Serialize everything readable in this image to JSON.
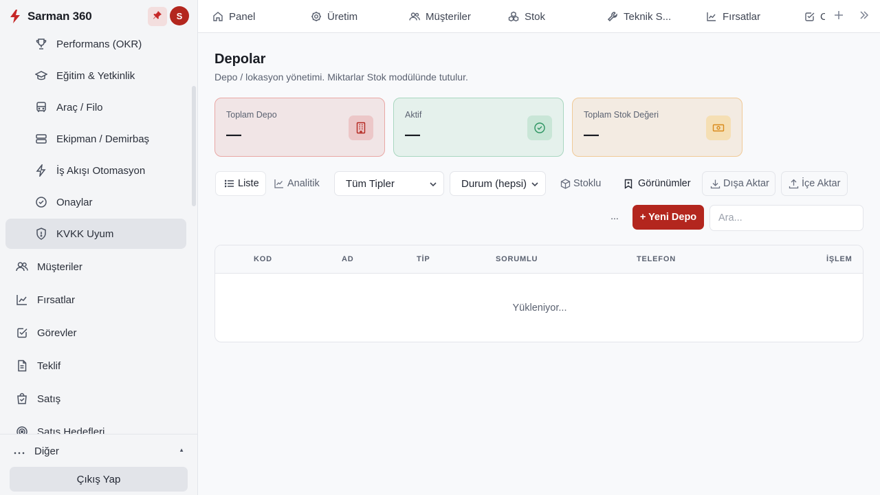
{
  "app": {
    "title": "Sarman 360",
    "avatar_initial": "S",
    "accent": "#b3261e"
  },
  "sidebar": {
    "sub_items": [
      {
        "label": "Performans (OKR)",
        "icon": "trophy-icon"
      },
      {
        "label": "Eğitim & Yetkinlik",
        "icon": "graduation-cap-icon"
      },
      {
        "label": "Araç / Filo",
        "icon": "bus-icon"
      },
      {
        "label": "Ekipman / Demirbaş",
        "icon": "server-icon"
      },
      {
        "label": "İş Akışı Otomasyon",
        "icon": "bolt-icon"
      },
      {
        "label": "Onaylar",
        "icon": "check-circle-icon"
      },
      {
        "label": "KVKK Uyum",
        "icon": "shield-icon"
      }
    ],
    "items": [
      {
        "label": "Müşteriler",
        "icon": "users-icon"
      },
      {
        "label": "Fırsatlar",
        "icon": "trending-icon"
      },
      {
        "label": "Görevler",
        "icon": "checkbox-icon"
      },
      {
        "label": "Teklif",
        "icon": "file-icon"
      },
      {
        "label": "Satış",
        "icon": "shopping-bag-icon"
      },
      {
        "label": "Satış Hedefleri",
        "icon": "target-icon"
      }
    ],
    "other_label": "Diğer",
    "logout_label": "Çıkış Yap"
  },
  "tabs": [
    {
      "label": "Panel",
      "icon": "home-icon"
    },
    {
      "label": "Üretim",
      "icon": "gear-icon"
    },
    {
      "label": "Müşteriler",
      "icon": "users-icon"
    },
    {
      "label": "Stok",
      "icon": "boxes-icon"
    },
    {
      "label": "Teknik S...",
      "icon": "wrench-icon"
    },
    {
      "label": "Fırsatlar",
      "icon": "trending-icon"
    },
    {
      "label": "C",
      "icon": "checkbox-icon"
    }
  ],
  "page": {
    "title": "Depolar",
    "subtitle": "Depo / lokasyon yönetimi. Miktarlar Stok modülünde tutulur."
  },
  "stats": [
    {
      "label": "Toplam Depo",
      "value": "—",
      "icon": "building-icon",
      "color": "#b3261e"
    },
    {
      "label": "Aktif",
      "value": "—",
      "icon": "check-circle-icon",
      "color": "#2b9360"
    },
    {
      "label": "Toplam Stok Değeri",
      "value": "—",
      "icon": "cash-icon",
      "color": "#d98a1a"
    }
  ],
  "toolbar": {
    "list_label": "Liste",
    "analytics_label": "Analitik",
    "type_filter": "Tüm Tipler",
    "status_filter": "Durum (hepsi)",
    "stocked_label": "Stoklu",
    "views_label": "Görünümler",
    "export_label": "Dışa Aktar",
    "import_label": "İçe Aktar",
    "more_label": "...",
    "new_label": "+ Yeni Depo",
    "search_placeholder": "Ara..."
  },
  "table": {
    "columns": [
      "KOD",
      "AD",
      "TİP",
      "SORUMLU",
      "TELEFON",
      "İŞLEM"
    ],
    "loading_text": "Yükleniyor..."
  }
}
